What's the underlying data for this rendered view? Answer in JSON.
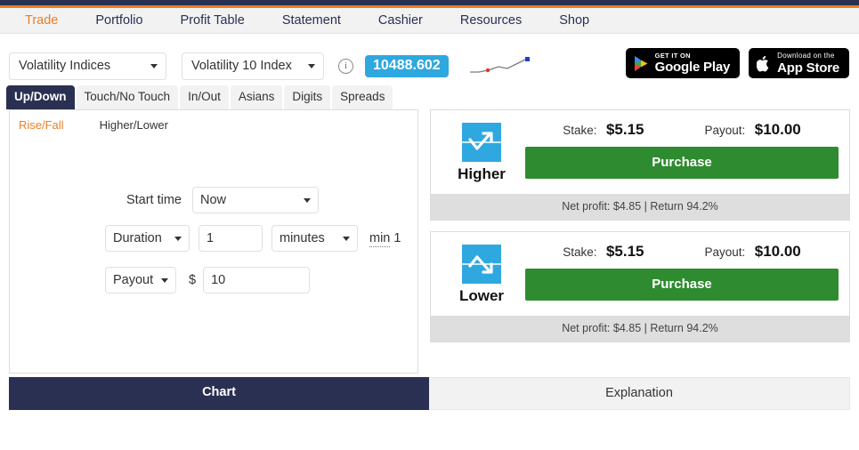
{
  "nav": {
    "items": [
      {
        "label": "Trade",
        "active": true
      },
      {
        "label": "Portfolio",
        "active": false
      },
      {
        "label": "Profit Table",
        "active": false
      },
      {
        "label": "Statement",
        "active": false
      },
      {
        "label": "Cashier",
        "active": false
      },
      {
        "label": "Resources",
        "active": false
      },
      {
        "label": "Shop",
        "active": false
      }
    ]
  },
  "market": {
    "type_selected": "Volatility Indices",
    "underlying_selected": "Volatility 10 Index",
    "info_icon_glyph": "i",
    "spot_price": "10488.602",
    "spot_badge_color": "#2fa8e0"
  },
  "store": {
    "google": {
      "small": "GET IT ON",
      "big": "Google Play"
    },
    "apple": {
      "small": "Download on the",
      "big": "App Store"
    }
  },
  "contract_tabs": [
    {
      "label": "Up/Down",
      "active": true
    },
    {
      "label": "Touch/No Touch",
      "active": false
    },
    {
      "label": "In/Out",
      "active": false
    },
    {
      "label": "Asians",
      "active": false
    },
    {
      "label": "Digits",
      "active": false
    },
    {
      "label": "Spreads",
      "active": false
    }
  ],
  "form": {
    "subtabs": [
      {
        "label": "Rise/Fall",
        "active": true
      },
      {
        "label": "Higher/Lower",
        "active": false
      }
    ],
    "start_time_label": "Start time",
    "start_time_value": "Now",
    "duration_mode_value": "Duration",
    "duration_amount_value": "1",
    "duration_unit_value": "minutes",
    "duration_min_word": "min",
    "duration_min_value": "1",
    "amount_type_value": "Payout",
    "currency_symbol": "$",
    "amount_value": "10"
  },
  "purchase_cards": [
    {
      "direction": "Higher",
      "icon": "trend-up-icon",
      "stake_label": "Stake:",
      "stake_value": "$5.15",
      "payout_label": "Payout:",
      "payout_value": "$10.00",
      "button_label": "Purchase",
      "footer": "Net profit: $4.85 | Return 94.2%"
    },
    {
      "direction": "Lower",
      "icon": "trend-down-icon",
      "stake_label": "Stake:",
      "stake_value": "$5.15",
      "payout_label": "Payout:",
      "payout_value": "$10.00",
      "button_label": "Purchase",
      "footer": "Net profit: $4.85 | Return 94.2%"
    }
  ],
  "bottom_tabs": [
    {
      "label": "Chart",
      "active": true
    },
    {
      "label": "Explanation",
      "active": false
    }
  ],
  "colors": {
    "brand_navy": "#2a3052",
    "brand_orange": "#e98024",
    "accent_blue": "#2fa8e0",
    "purchase_green": "#2e8b30"
  }
}
